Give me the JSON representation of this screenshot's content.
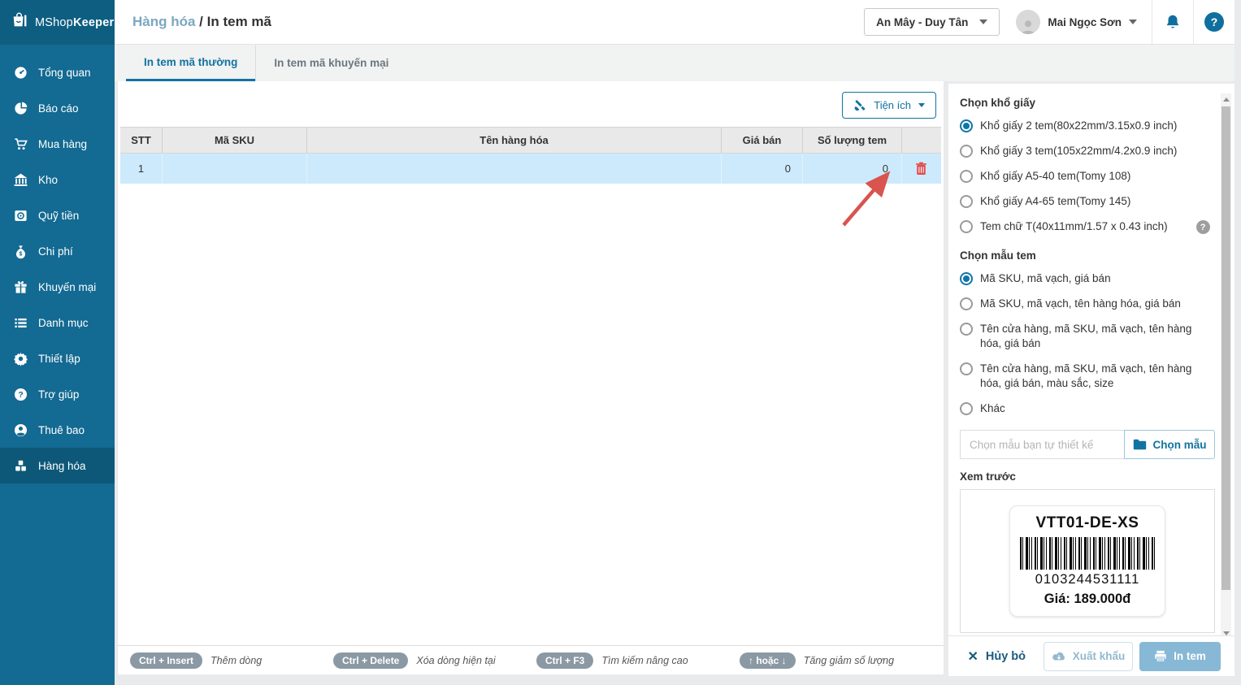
{
  "app": {
    "brand_prefix": "MShop",
    "brand_suffix": "Keeper"
  },
  "header": {
    "breadcrumb_parent": "Hàng hóa",
    "breadcrumb_sep": " / ",
    "breadcrumb_current": "In tem mã",
    "store": "An Mây - Duy Tân",
    "user": "Mai Ngọc Sơn",
    "help": "?"
  },
  "sidebar": {
    "items": [
      {
        "label": "Tổng quan"
      },
      {
        "label": "Báo cáo"
      },
      {
        "label": "Mua hàng"
      },
      {
        "label": "Kho"
      },
      {
        "label": "Quỹ tiền"
      },
      {
        "label": "Chi phí"
      },
      {
        "label": "Khuyến mại"
      },
      {
        "label": "Danh mục"
      },
      {
        "label": "Thiết lập"
      },
      {
        "label": "Trợ giúp"
      },
      {
        "label": "Thuê bao"
      },
      {
        "label": "Hàng hóa"
      }
    ]
  },
  "tabs": {
    "normal": "In tem mã thường",
    "promo": "In tem mã khuyến mại"
  },
  "toolbar": {
    "utilities": "Tiện ích"
  },
  "table": {
    "headers": {
      "stt": "STT",
      "sku": "Mã SKU",
      "name": "Tên hàng hóa",
      "price": "Giá bán",
      "qty": "Số lượng tem"
    },
    "rows": [
      {
        "stt": "1",
        "sku": "",
        "name": "",
        "price": "0",
        "qty": "0"
      }
    ]
  },
  "paper": {
    "title": "Chọn khổ giấy",
    "options": [
      {
        "label": "Khổ giấy 2 tem(80x22mm/3.15x0.9 inch)",
        "selected": true
      },
      {
        "label": "Khổ giấy 3 tem(105x22mm/4.2x0.9 inch)",
        "selected": false
      },
      {
        "label": "Khổ giấy A5-40 tem(Tomy 108)",
        "selected": false
      },
      {
        "label": "Khổ giấy A4-65 tem(Tomy 145)",
        "selected": false
      },
      {
        "label": "Tem chữ T(40x11mm/1.57 x 0.43 inch)",
        "selected": false,
        "has_help": true
      }
    ]
  },
  "template": {
    "title": "Chọn mẫu tem",
    "options": [
      {
        "label": "Mã SKU, mã vạch, giá bán",
        "selected": true
      },
      {
        "label": "Mã SKU, mã vạch, tên hàng hóa, giá bán",
        "selected": false
      },
      {
        "label": "Tên cửa hàng, mã SKU, mã vạch, tên hàng hóa, giá bán",
        "selected": false
      },
      {
        "label": "Tên cửa hàng, mã SKU, mã vạch, tên hàng hóa, giá bán, màu sắc, size",
        "selected": false
      },
      {
        "label": "Khác",
        "selected": false
      }
    ]
  },
  "custom": {
    "placeholder": "Chọn mẫu bạn tự thiết kế",
    "button": "Chọn mẫu"
  },
  "preview": {
    "title": "Xem trước",
    "sku": "VTT01-DE-XS",
    "barcode_number": "0103244531111",
    "price": "Giá: 189.000đ"
  },
  "shortcuts": [
    {
      "keys": "Ctrl + Insert",
      "desc": "Thêm dòng"
    },
    {
      "keys": "Ctrl + Delete",
      "desc": "Xóa dòng hiện tại"
    },
    {
      "keys": "Ctrl + F3",
      "desc": "Tìm kiếm nâng cao"
    },
    {
      "keys": "↑ hoặc ↓",
      "desc": "Tăng giảm số lượng"
    }
  ],
  "actions": {
    "cancel": "Hủy bỏ",
    "export": "Xuất khẩu",
    "print": "In tem"
  },
  "colors": {
    "accent": "#1173a1",
    "sidebar": "#136a92",
    "sidebar_active": "#0d5878",
    "row_highlight": "#cdeafc",
    "danger": "#e04b4b",
    "arrow": "#d9534f"
  }
}
